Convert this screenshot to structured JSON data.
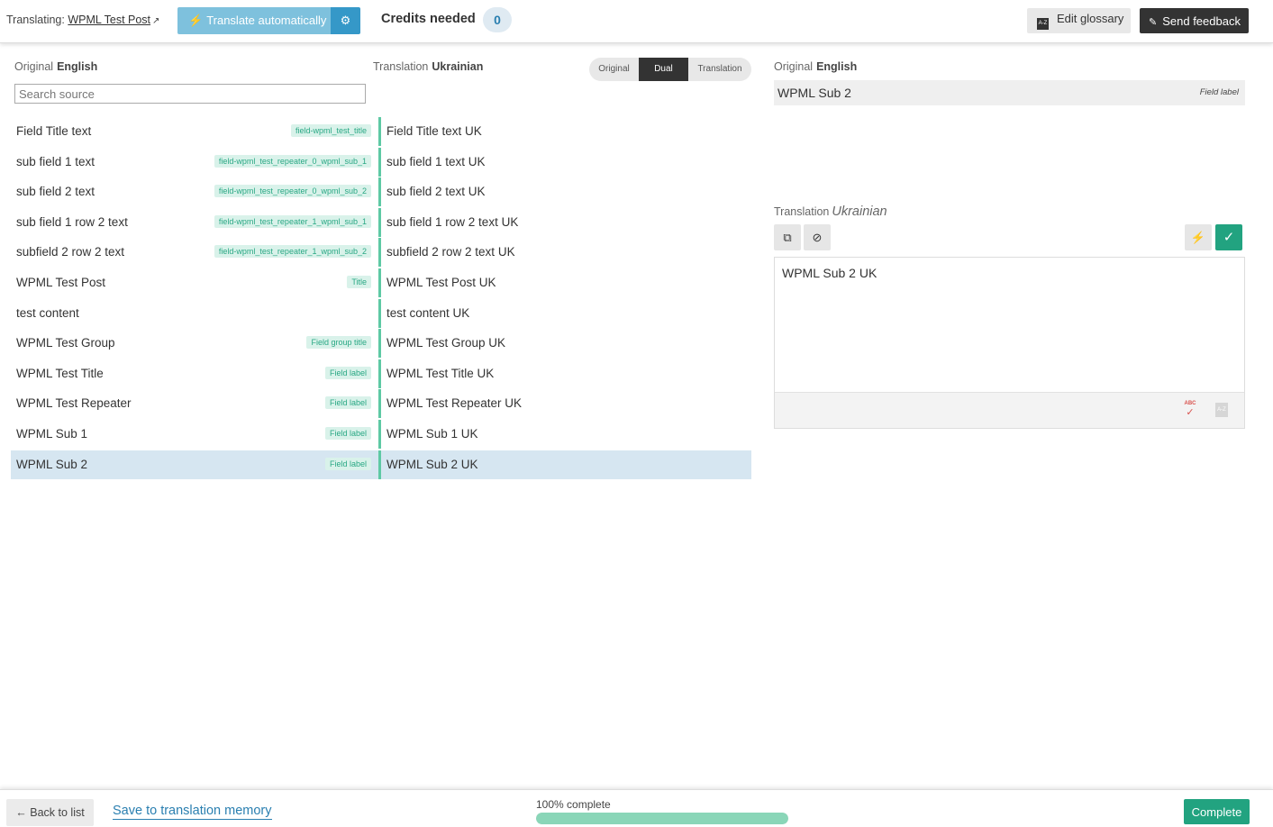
{
  "header": {
    "translating_label": "Translating:",
    "post_link": "WPML Test Post",
    "translate_auto_label": "Translate automatically",
    "credits_label": "Credits needed",
    "credits_value": "0",
    "glossary_label": "Edit glossary",
    "glossary_icon_text": "A-Z",
    "feedback_label": "Send feedback"
  },
  "left": {
    "original_label": "Original",
    "original_lang": "English",
    "translation_label": "Translation",
    "translation_lang": "Ukrainian",
    "search_placeholder": "Search source",
    "view_modes": [
      "Original",
      "Dual",
      "Translation"
    ],
    "active_view": "Dual"
  },
  "segments": [
    {
      "source": "Field Title text",
      "tag": "field-wpml_test_title",
      "target": "Field Title text UK"
    },
    {
      "source": "sub field 1 text",
      "tag": "field-wpml_test_repeater_0_wpml_sub_1",
      "target": "sub field 1 text UK"
    },
    {
      "source": "sub field 2 text",
      "tag": "field-wpml_test_repeater_0_wpml_sub_2",
      "target": "sub field 2 text UK"
    },
    {
      "source": "sub field 1 row 2 text",
      "tag": "field-wpml_test_repeater_1_wpml_sub_1",
      "target": "sub field 1 row 2 text UK"
    },
    {
      "source": "subfield 2 row 2 text",
      "tag": "field-wpml_test_repeater_1_wpml_sub_2",
      "target": "subfield 2 row 2 text UK"
    },
    {
      "source": "WPML Test Post",
      "tag": "Title",
      "target": "WPML Test Post UK"
    },
    {
      "source": "test content",
      "tag": "",
      "target": "test content UK"
    },
    {
      "source": "WPML Test Group",
      "tag": "Field group title",
      "target": "WPML Test Group UK"
    },
    {
      "source": "WPML Test Title",
      "tag": "Field label",
      "target": "WPML Test Title UK"
    },
    {
      "source": "WPML Test Repeater",
      "tag": "Field label",
      "target": "WPML Test Repeater UK"
    },
    {
      "source": "WPML Sub 1",
      "tag": "Field label",
      "target": "WPML Sub 1 UK"
    },
    {
      "source": "WPML Sub 2",
      "tag": "Field label",
      "target": "WPML Sub 2 UK",
      "selected": true
    }
  ],
  "editor": {
    "original_label": "Original",
    "original_lang": "English",
    "original_text": "WPML Sub 2",
    "original_tag": "Field label",
    "translation_label": "Translation",
    "translation_lang": "Ukrainian",
    "translation_text": "WPML Sub 2 UK",
    "spell_icon_text": "ABC",
    "az_icon_text": "A-Z"
  },
  "footer": {
    "back_label": "← Back to list",
    "save_tm_label": "Save to translation memory",
    "progress_label": "100% complete",
    "progress_percent": 100,
    "complete_label": "Complete"
  },
  "colors": {
    "accent_green": "#22a380",
    "tag_green": "#29a884",
    "auto_button": "#7ec1dd",
    "selected_row": "#d6e6f1"
  }
}
